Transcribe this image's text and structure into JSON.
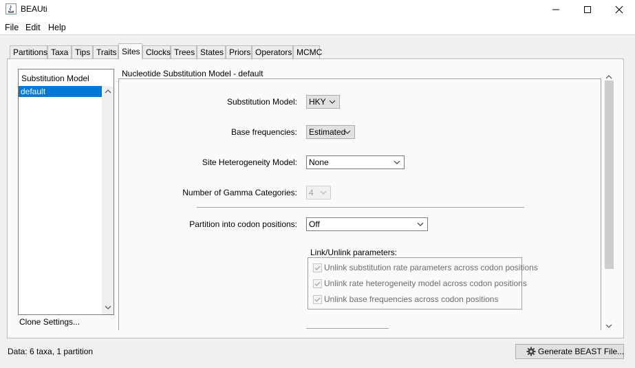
{
  "window": {
    "title": "BEAUti"
  },
  "menu": [
    "File",
    "Edit",
    "Help"
  ],
  "tabs": [
    "Partitions",
    "Taxa",
    "Tips",
    "Traits",
    "Sites",
    "Clocks",
    "Trees",
    "States",
    "Priors",
    "Operators",
    "MCMC"
  ],
  "active_tab": "Sites",
  "left_panel": {
    "header": "Substitution Model",
    "items": [
      "default"
    ],
    "clone_settings": "Clone Settings..."
  },
  "main": {
    "section_title": "Nucleotide Substitution Model - default",
    "substitution_model": {
      "label": "Substitution Model:",
      "value": "HKY"
    },
    "base_frequencies": {
      "label": "Base frequencies:",
      "value": "Estimated"
    },
    "site_heterogeneity": {
      "label": "Site Heterogeneity Model:",
      "value": "None"
    },
    "gamma_categories": {
      "label": "Number of Gamma Categories:",
      "value": "4"
    },
    "codon_partition": {
      "label": "Partition into codon positions:",
      "value": "Off"
    },
    "link_group": {
      "title": "Link/Unlink parameters:",
      "options": [
        "Unlink substitution rate parameters across codon positions",
        "Unlink rate heterogeneity model across codon positions",
        "Unlink base frequencies across codon positions"
      ]
    }
  },
  "status": {
    "text": "Data: 6 taxa, 1 partition"
  },
  "generate_button": "Generate BEAST File..."
}
